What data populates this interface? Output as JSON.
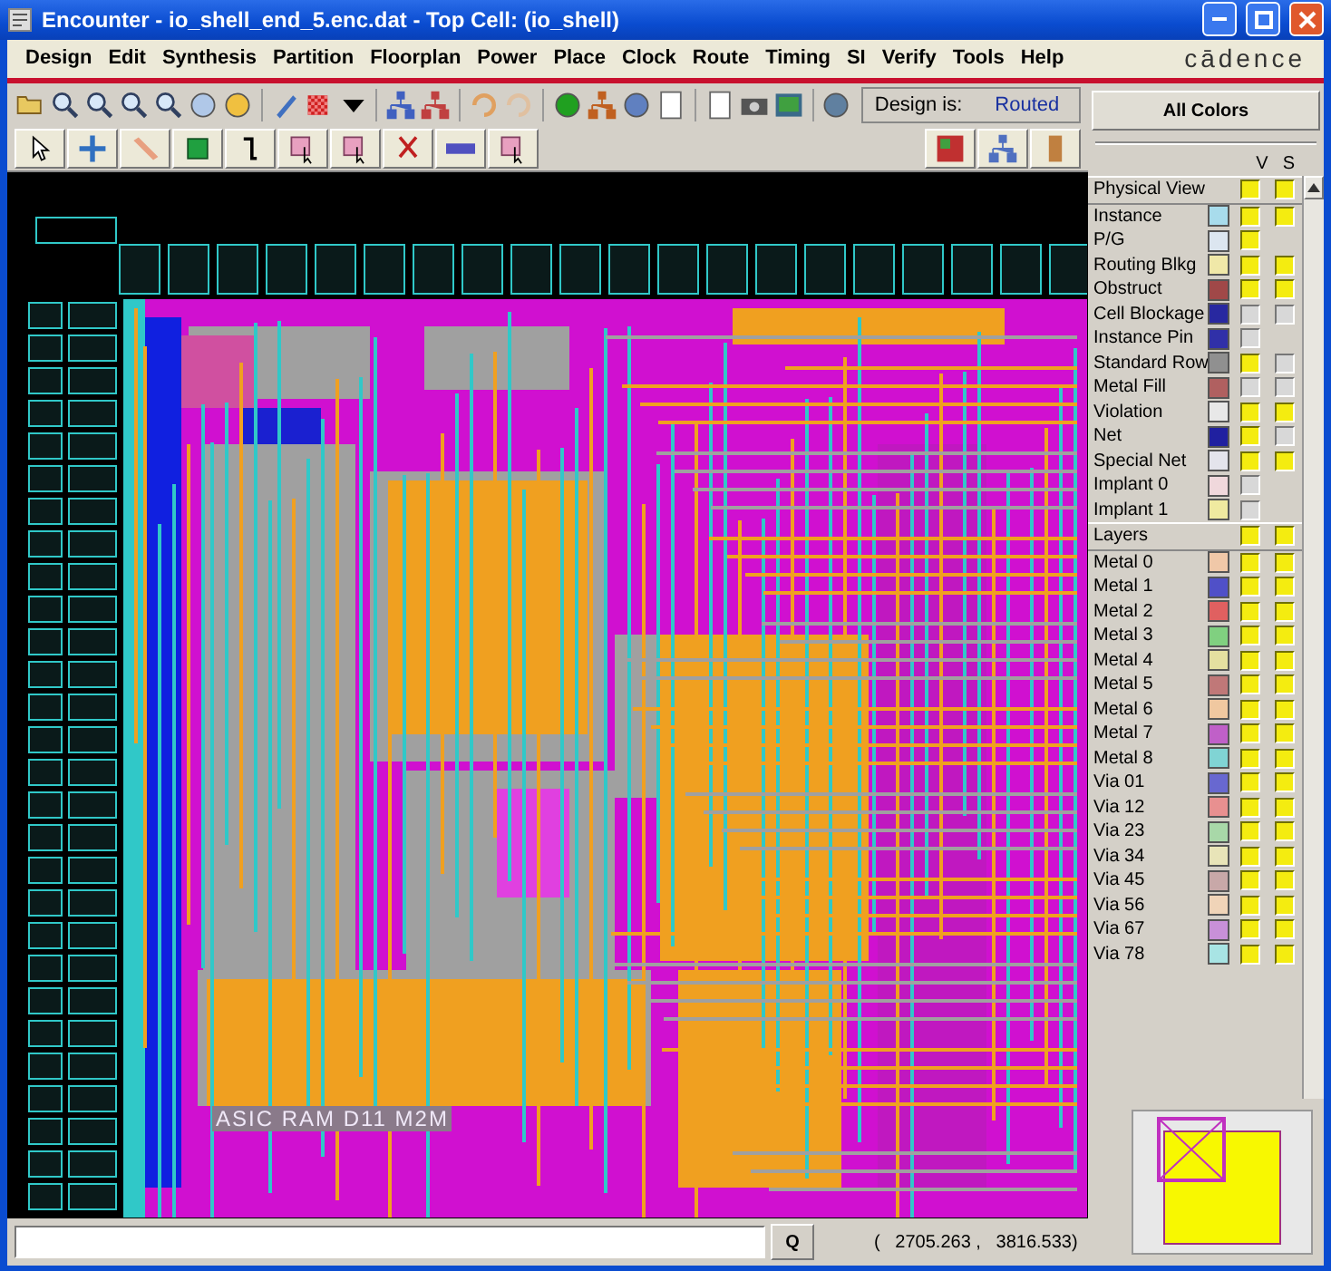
{
  "window": {
    "title": "Encounter - io_shell_end_5.enc.dat - Top Cell: (io_shell)"
  },
  "menu": [
    "Design",
    "Edit",
    "Synthesis",
    "Partition",
    "Floorplan",
    "Power",
    "Place",
    "Clock",
    "Route",
    "Timing",
    "SI",
    "Verify",
    "Tools",
    "Help"
  ],
  "brand": "cādence",
  "toolbar": {
    "design_label": "Design is:",
    "design_state": "Routed"
  },
  "canvas": {
    "label": "ASIC RAM D11 M2M"
  },
  "layer_panel": {
    "all_colors_button": "All Colors",
    "columns": [
      "V",
      "S"
    ],
    "sections": [
      {
        "title": "Physical View",
        "visible": true,
        "selectable": true,
        "items": [
          {
            "name": "Instance",
            "color": "#a8dcec",
            "visible": true,
            "selectable": true
          },
          {
            "name": "P/G",
            "color": "#dce6f0",
            "visible": true
          },
          {
            "name": "Routing Blkg",
            "color": "#f0e8a8",
            "visible": true,
            "selectable": true
          },
          {
            "name": "Obstruct",
            "color": "#a04848",
            "visible": true,
            "selectable": true
          },
          {
            "name": "Cell Blockage",
            "color": "#2828a0",
            "visible": false,
            "selectable": false
          },
          {
            "name": "Instance Pin",
            "color": "#3030a8",
            "visible": false
          },
          {
            "name": "Standard Row",
            "color": "#909090",
            "visible": true,
            "selectable": false
          },
          {
            "name": "Metal Fill",
            "color": "#b06060",
            "visible": false,
            "selectable": false
          },
          {
            "name": "Violation",
            "color": "#e8e8e8",
            "visible": true,
            "selectable": true
          },
          {
            "name": "Net",
            "color": "#2020a0",
            "visible": true,
            "selectable": false
          },
          {
            "name": "Special Net",
            "color": "#e4e4ec",
            "visible": true,
            "selectable": true
          },
          {
            "name": "Implant 0",
            "color": "#f0d8dc",
            "visible": false
          },
          {
            "name": "Implant 1",
            "color": "#f0eaa0",
            "visible": false
          }
        ]
      },
      {
        "title": "Layers",
        "visible": true,
        "selectable": true,
        "items": [
          {
            "name": "Metal 0",
            "color": "#f0c8a8",
            "visible": true,
            "selectable": true
          },
          {
            "name": "Metal 1",
            "color": "#5050c8",
            "visible": true,
            "selectable": true
          },
          {
            "name": "Metal 2",
            "color": "#e06060",
            "visible": true,
            "selectable": true
          },
          {
            "name": "Metal 3",
            "color": "#80d080",
            "visible": true,
            "selectable": true
          },
          {
            "name": "Metal 4",
            "color": "#e4e0a0",
            "visible": true,
            "selectable": true
          },
          {
            "name": "Metal 5",
            "color": "#c07878",
            "visible": true,
            "selectable": true
          },
          {
            "name": "Metal 6",
            "color": "#f0c8a0",
            "visible": true,
            "selectable": true
          },
          {
            "name": "Metal 7",
            "color": "#c060c8",
            "visible": true,
            "selectable": true
          },
          {
            "name": "Metal 8",
            "color": "#80d4d4",
            "visible": true,
            "selectable": true
          },
          {
            "name": "Via 01",
            "color": "#6868d0",
            "visible": true,
            "selectable": true
          },
          {
            "name": "Via 12",
            "color": "#e89090",
            "visible": true,
            "selectable": true
          },
          {
            "name": "Via 23",
            "color": "#a8d8a8",
            "visible": true,
            "selectable": true
          },
          {
            "name": "Via 34",
            "color": "#e8e4b8",
            "visible": true,
            "selectable": true
          },
          {
            "name": "Via 45",
            "color": "#c8a8a8",
            "visible": true,
            "selectable": true
          },
          {
            "name": "Via 56",
            "color": "#f0d4b8",
            "visible": true,
            "selectable": true
          },
          {
            "name": "Via 67",
            "color": "#c890d8",
            "visible": true,
            "selectable": true
          },
          {
            "name": "Via 78",
            "color": "#a8e4e4",
            "visible": true,
            "selectable": true
          }
        ]
      }
    ]
  },
  "status_bar": {
    "query_button": "Q",
    "coordinates": "(   2705.263 ,   3816.533)"
  }
}
